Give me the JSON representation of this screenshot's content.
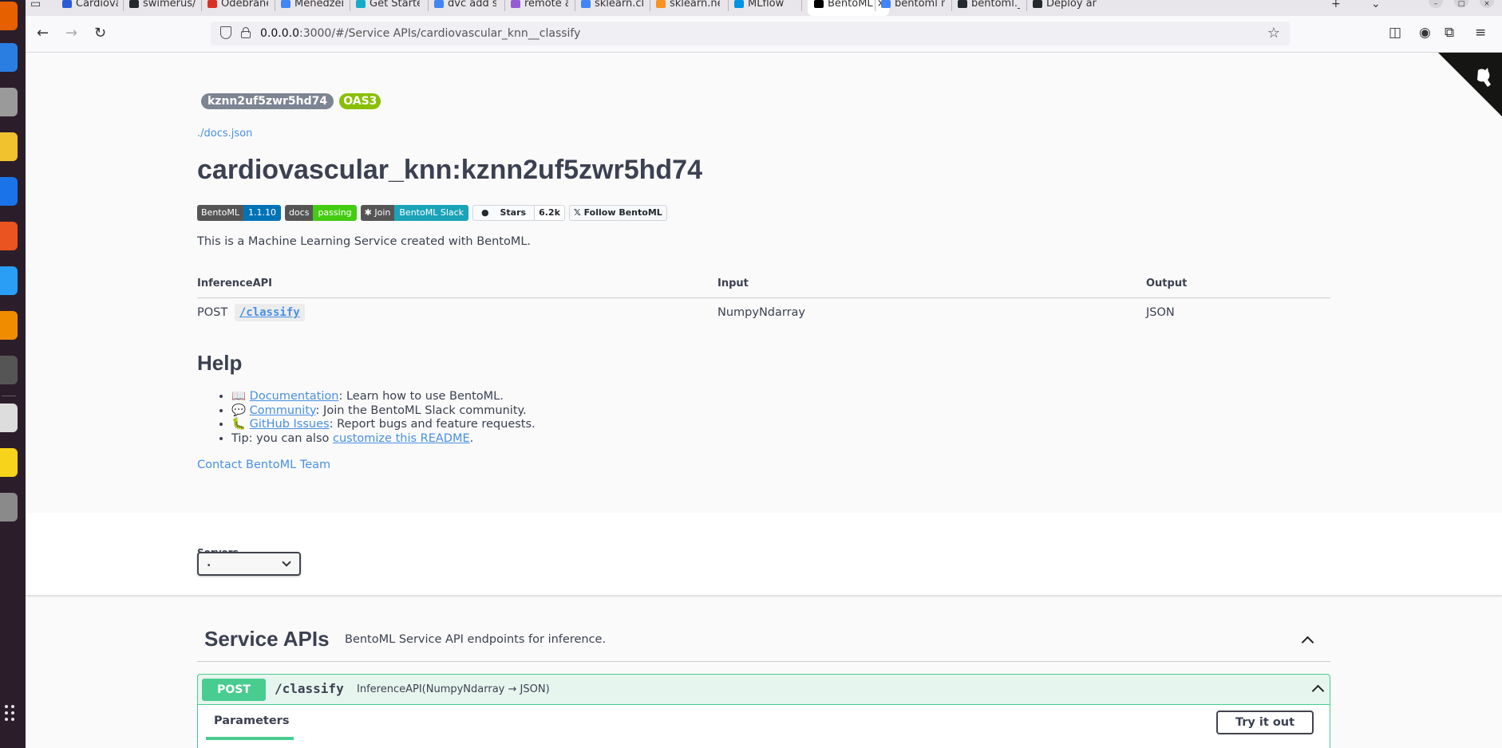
{
  "browser": {
    "tabs": [
      {
        "label": "Cardiovasc",
        "color": "#2a5bd7",
        "glyph": "K"
      },
      {
        "label": "swimerus/",
        "color": "#24292e",
        "glyph": "gh"
      },
      {
        "label": "Odebrane",
        "color": "#d93025",
        "glyph": "M"
      },
      {
        "label": "Menedżer",
        "color": "#4285f4",
        "glyph": "G"
      },
      {
        "label": "Get Starte",
        "color": "#13adc7",
        "glyph": "dvc"
      },
      {
        "label": "dvc add st",
        "color": "#4285f4",
        "glyph": "G"
      },
      {
        "label": "remote ad",
        "color": "#945dd6",
        "glyph": "dvc"
      },
      {
        "label": "sklearn.cla",
        "color": "#4285f4",
        "glyph": "G"
      },
      {
        "label": "sklearn.ne",
        "color": "#f7931e",
        "glyph": "sk"
      },
      {
        "label": "MLflow",
        "color": "#0194e2",
        "glyph": "ml"
      },
      {
        "label": "BentoML",
        "color": "#000000",
        "glyph": "b",
        "active": true
      },
      {
        "label": "bentoml m",
        "color": "#4285f4",
        "glyph": "G"
      },
      {
        "label": "bentoml._",
        "color": "#24292e",
        "glyph": "doc"
      },
      {
        "label": "Deploy an",
        "color": "#24292e",
        "glyph": "doc"
      }
    ],
    "url_host": "0.0.0.0",
    "url_rest": ":3000/#/Service APIs/cardiovascular_knn__classify"
  },
  "info": {
    "version_badge": "kznn2uf5zwr5hd74",
    "oas_badge": "OAS3",
    "docs_link": "./docs.json",
    "title": "cardiovascular_knn:kznn2uf5zwr5hd74",
    "shields": {
      "bentoml_label": "BentoML",
      "bentoml_value": "1.1.10",
      "docs_label": "docs",
      "docs_value": "passing",
      "slack_label": "Join",
      "slack_value": "BentoML Slack",
      "stars_label": "Stars",
      "stars_count": "6.2k",
      "follow_label": "Follow BentoML"
    },
    "description": "This is a Machine Learning Service created with BentoML."
  },
  "api_table": {
    "headers": [
      "InferenceAPI",
      "Input",
      "Output"
    ],
    "rows": [
      {
        "method": "POST",
        "path": "/classify",
        "input": "NumpyNdarray",
        "output": "JSON"
      }
    ]
  },
  "help": {
    "title": "Help",
    "items": [
      {
        "emoji": "📖",
        "link": "Documentation",
        "text": ": Learn how to use BentoML."
      },
      {
        "emoji": "💬",
        "link": "Community",
        "text": ": Join the BentoML Slack community."
      },
      {
        "emoji": "🐛",
        "link": "GitHub Issues",
        "text": ": Report bugs and feature requests."
      }
    ],
    "tip_prefix": "Tip: you can also ",
    "tip_link": "customize this README",
    "tip_suffix": ".",
    "contact": "Contact BentoML Team"
  },
  "servers": {
    "label": "Servers",
    "selected": "."
  },
  "service_apis": {
    "title": "Service APIs",
    "subtitle": "BentoML Service API endpoints for inference.",
    "operation": {
      "method": "POST",
      "path": "/classify",
      "description": "InferenceAPI(NumpyNdarray → JSON)",
      "parameters_tab": "Parameters",
      "try_button": "Try it out"
    }
  },
  "colors": {
    "post_green": "#49cc90",
    "link_blue": "#4990e2",
    "oas_green": "#89bf04",
    "version_grey": "#7d8492"
  }
}
